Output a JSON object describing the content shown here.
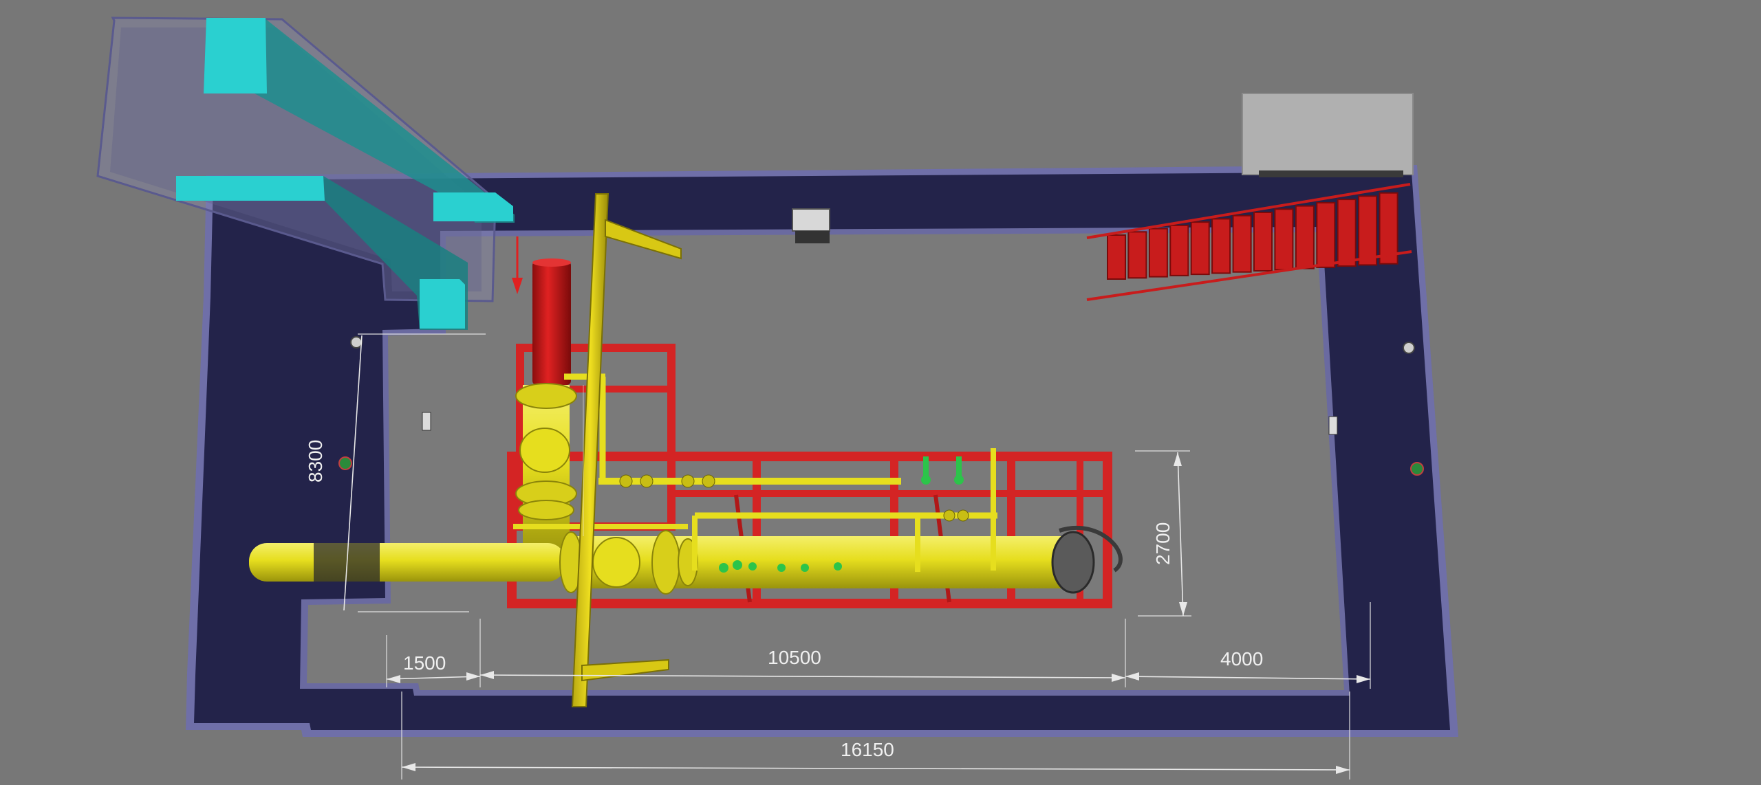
{
  "dimensions": {
    "pit_length": "16150",
    "left_offset": "1500",
    "equipment_length": "10500",
    "right_offset": "4000",
    "pit_width": "8300",
    "equipment_width": "2700"
  },
  "colors": {
    "background": "#777777",
    "pit_wall": "#23234a",
    "pit_rim": "#6f6fa8",
    "pit_floor": "#7a7a7a",
    "pipeline": "#e8e024",
    "skid_frame": "#d42424",
    "ducts": "#2ad0d0",
    "valves": "#2cc44a",
    "stairs": "#c81c1c",
    "cabinet": "#b0b0b0"
  }
}
